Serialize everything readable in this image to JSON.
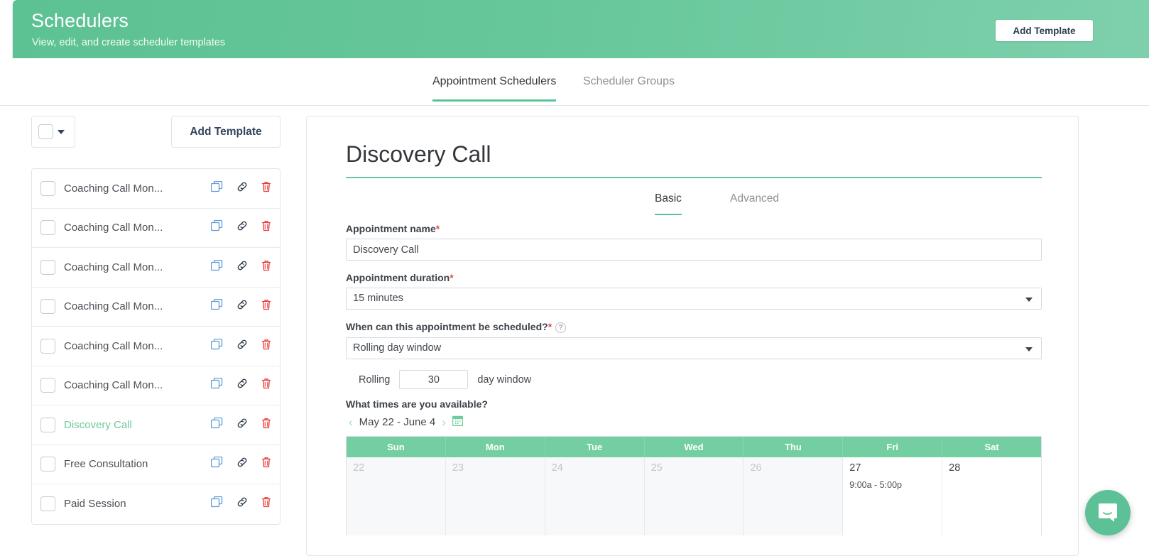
{
  "header": {
    "title": "Schedulers",
    "subtitle": "View, edit, and create scheduler templates",
    "add_template_label": "Add Template",
    "accent_color": "#5cc193"
  },
  "top_tabs": [
    {
      "label": "Appointment Schedulers",
      "active": true
    },
    {
      "label": "Scheduler Groups",
      "active": false
    }
  ],
  "sidebar": {
    "add_template_label": "Add Template",
    "items": [
      {
        "label": "Coaching Call Mon...",
        "selected": false
      },
      {
        "label": "Coaching Call Mon...",
        "selected": false
      },
      {
        "label": "Coaching Call Mon...",
        "selected": false
      },
      {
        "label": "Coaching Call Mon...",
        "selected": false
      },
      {
        "label": "Coaching Call Mon...",
        "selected": false
      },
      {
        "label": "Coaching Call Mon...",
        "selected": false
      },
      {
        "label": "Discovery Call",
        "selected": true
      },
      {
        "label": "Free Consultation",
        "selected": false
      },
      {
        "label": "Paid Session",
        "selected": false
      }
    ],
    "row_icons": [
      "duplicate-icon",
      "link-icon",
      "delete-icon"
    ],
    "selected_color": "#6ecb9d"
  },
  "main": {
    "title": "Discovery Call",
    "sub_tabs": [
      {
        "label": "Basic",
        "active": true
      },
      {
        "label": "Advanced",
        "active": false
      }
    ],
    "fields": {
      "name_label": "Appointment name",
      "name_value": "Discovery Call",
      "duration_label": "Appointment duration",
      "duration_value": "15 minutes",
      "when_label": "When can this appointment be scheduled?",
      "when_value": "Rolling day window",
      "help_glyph": "?",
      "required_mark": "*",
      "rolling_prefix": "Rolling",
      "rolling_value": "30",
      "rolling_suffix": "day window",
      "available_label": "What times are you available?"
    },
    "date_range": {
      "prev_glyph": "‹",
      "next_glyph": "›",
      "range_text": "May 22 -  June 4"
    },
    "calendar": {
      "day_headers": [
        "Sun",
        "Mon",
        "Tue",
        "Wed",
        "Thu",
        "Fri",
        "Sat"
      ],
      "header_color": "#73cfa2",
      "cells": [
        {
          "day": "22",
          "past": true,
          "slot": ""
        },
        {
          "day": "23",
          "past": true,
          "slot": ""
        },
        {
          "day": "24",
          "past": true,
          "slot": ""
        },
        {
          "day": "25",
          "past": true,
          "slot": ""
        },
        {
          "day": "26",
          "past": true,
          "slot": ""
        },
        {
          "day": "27",
          "past": false,
          "slot": "9:00a - 5:00p"
        },
        {
          "day": "28",
          "past": false,
          "slot": ""
        }
      ]
    }
  },
  "chat": {
    "icon": "chat-bubble-icon",
    "color": "#5cc196"
  }
}
